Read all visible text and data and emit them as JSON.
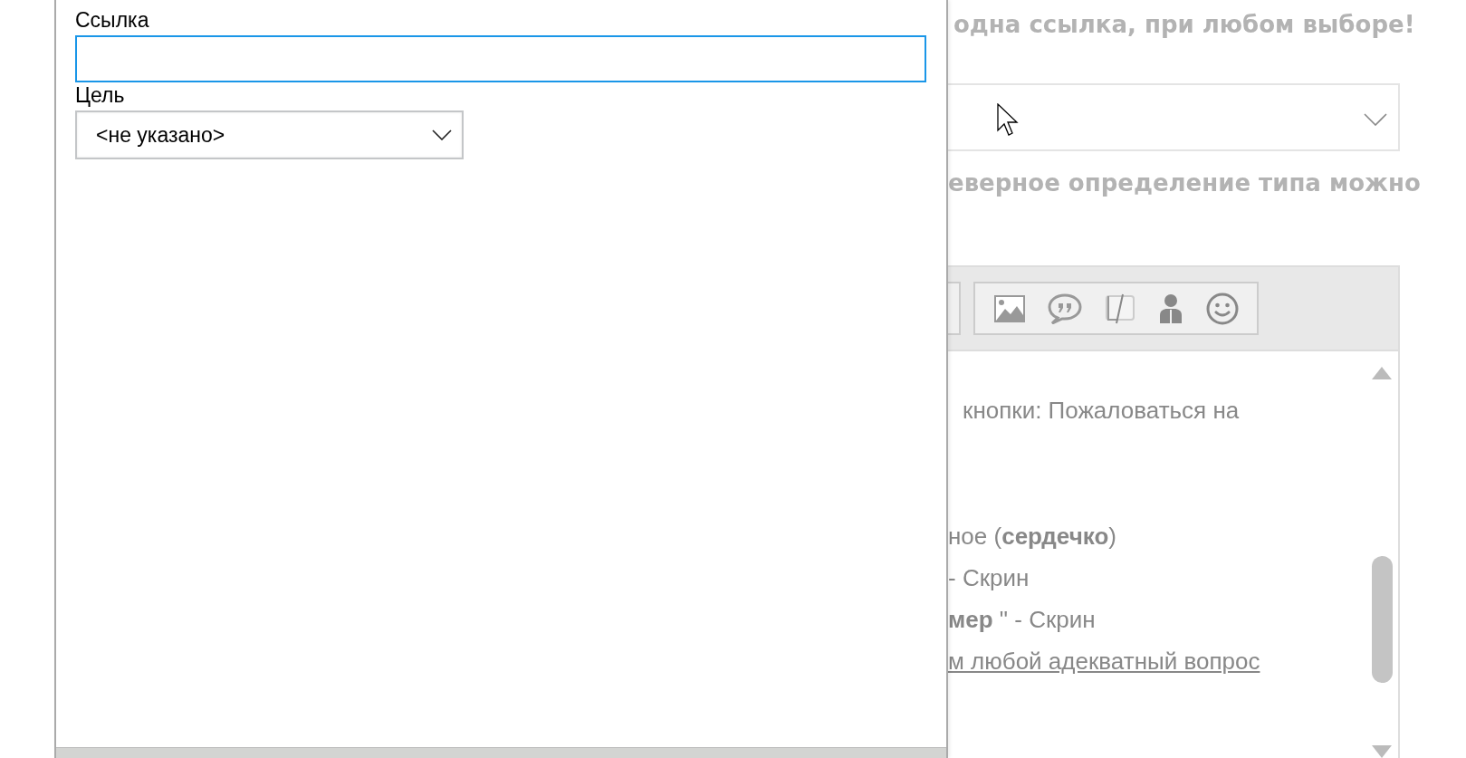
{
  "dialog": {
    "fields": [
      {
        "kind": "text",
        "label": "Ссылка",
        "focused": true
      },
      {
        "kind": "select",
        "label": "Цель",
        "value": "<не указано>"
      }
    ]
  },
  "background": {
    "heading": "одна ссылка, при любом выборе!",
    "hint": "еверное определение типа можно",
    "editor": {
      "intro": "кнопки: Пожаловаться на",
      "lines": [
        {
          "kind": "text",
          "text": "ное (**сердечко**)"
        },
        {
          "kind": "text",
          "text": "- Скрин"
        },
        {
          "kind": "text",
          "text": "**мер** \" - Скрин"
        },
        {
          "kind": "link",
          "text": "м любой адекватный вопрос"
        }
      ]
    }
  }
}
